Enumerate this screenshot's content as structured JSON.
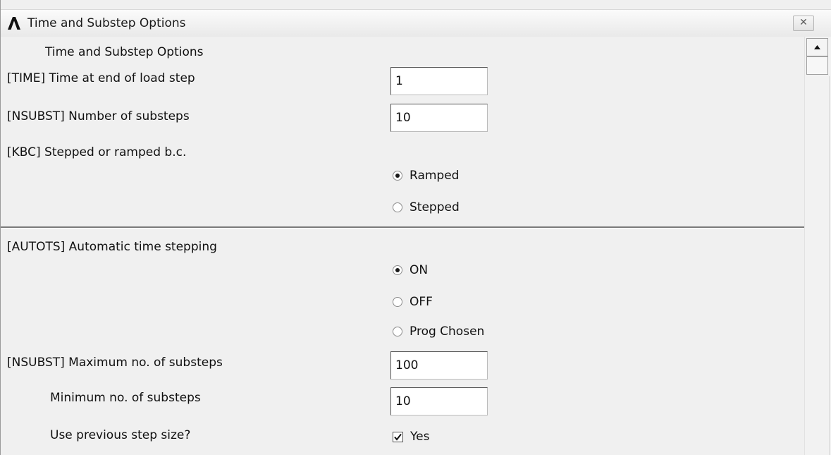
{
  "window": {
    "title": "Time and Substep Options",
    "close_glyph": "✕"
  },
  "section_title": "Time and Substep Options",
  "fields": {
    "time": {
      "label": "[TIME]  Time at end of load step",
      "value": "1"
    },
    "nsubst": {
      "label": "[NSUBST]  Number of substeps",
      "value": "10"
    },
    "kbc": {
      "label": "[KBC]     Stepped or ramped b.c.",
      "options": [
        {
          "label": "Ramped",
          "selected": true
        },
        {
          "label": "Stepped",
          "selected": false
        }
      ]
    },
    "autots": {
      "label": "[AUTOTS] Automatic time stepping",
      "options": [
        {
          "label": "ON",
          "selected": true
        },
        {
          "label": "OFF",
          "selected": false
        },
        {
          "label": "Prog Chosen",
          "selected": false
        }
      ]
    },
    "max_substeps": {
      "label": "[NSUBST] Maximum no. of substeps",
      "value": "100"
    },
    "min_substeps": {
      "label": "Minimum no. of substeps",
      "value": "10"
    },
    "use_prev": {
      "label": "Use previous step size?",
      "checkbox_label": "Yes",
      "checked": true
    }
  },
  "icons": {
    "app_logo": "ansys-logo-icon",
    "close": "close-icon",
    "scroll_up": "scroll-up-arrow-icon",
    "radio_on": "radio-selected-icon",
    "checkmark": "checkmark-icon"
  }
}
